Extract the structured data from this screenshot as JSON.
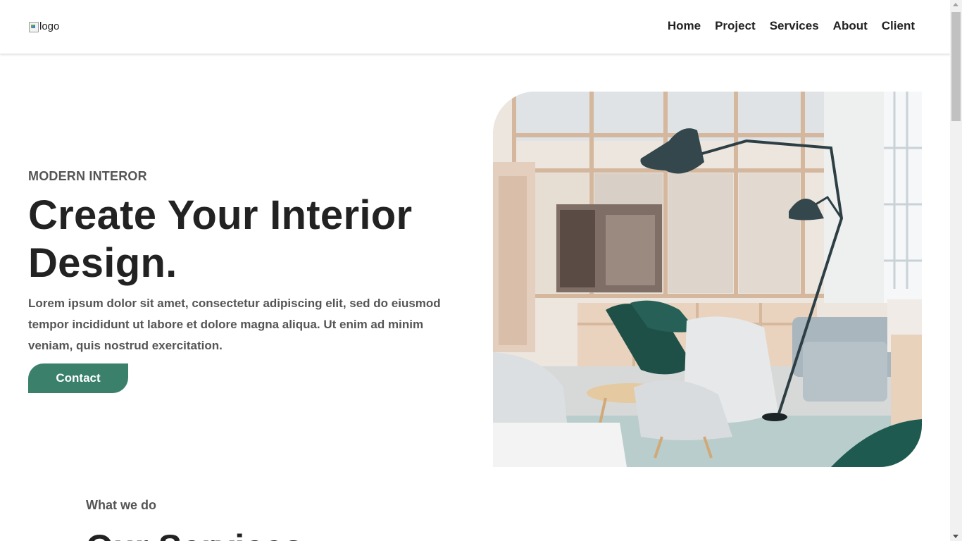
{
  "header": {
    "logo_alt": "logo",
    "nav": [
      "Home",
      "Project",
      "Services",
      "About",
      "Client"
    ]
  },
  "hero": {
    "eyebrow": "MODERN INTEROR",
    "title_line1": "Create Your Interior",
    "title_line2": "Design.",
    "text": "Lorem ipsum dolor sit amet, consectetur adipiscing elit, sed do eiusmod tempor incididunt ut labore et dolore magna aliqua. Ut enim ad minim veniam, quis nostrud exercitation.",
    "button": "Contact"
  },
  "services": {
    "eyebrow": "What we do",
    "title": "Our Services"
  },
  "colors": {
    "accent": "#3a806b",
    "text_dark": "#222222",
    "text_muted": "#555555"
  },
  "icons": {
    "broken_image": "broken-image-icon"
  }
}
